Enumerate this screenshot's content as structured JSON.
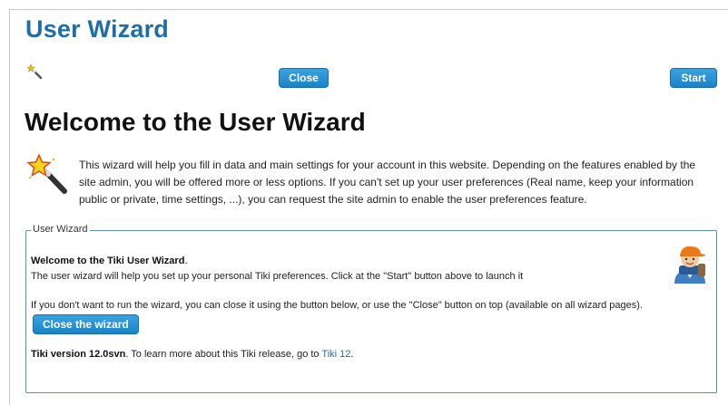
{
  "page": {
    "title": "User Wizard",
    "close_label": "Close",
    "start_label": "Start",
    "heading": "Welcome to the User Wizard",
    "intro": "This wizard will help you fill in data and main settings for your account in this website. Depending on the features enabled by the site admin, you will be offered more or less options. If you can't set up your user preferences (Real name, keep your information public or private, time settings, ...), you can request the site admin to enable the user preferences feature."
  },
  "panel": {
    "legend": "User Wizard",
    "welcome": "Welcome to the Tiki User Wizard",
    "welcome_suffix": ".",
    "line1": "The user wizard will help you set up your personal Tiki preferences. Click at the \"Start\" button above to launch it",
    "line2": "If you don't want to run the wizard, you can close it using the button below, or use the \"Close\" button on top (available on all wizard pages).",
    "close_wizard_label": "Close the wizard",
    "version_label": "Tiki version 12.0svn",
    "version_text": ". To learn more about this Tiki release, go to ",
    "version_link": "Tiki 12",
    "version_end": "."
  },
  "icons": {
    "wand": "magic-wand-icon",
    "avatar": "user-avatar-icon"
  },
  "colors": {
    "title": "#1f6fa7",
    "button": "#2590d4",
    "panel_border": "#5a8fb5",
    "link": "#1f6fa7"
  }
}
